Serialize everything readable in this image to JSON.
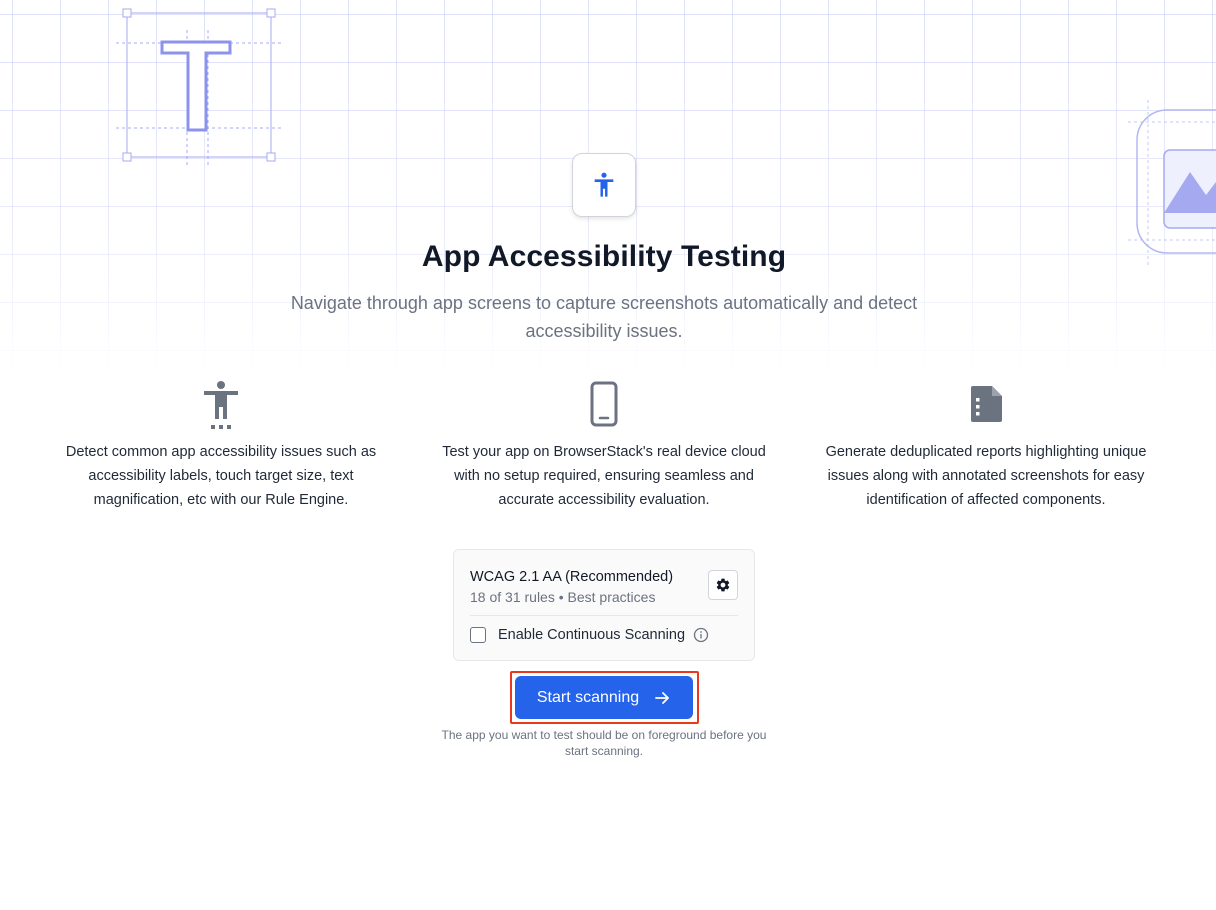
{
  "hero": {
    "title": "App Accessibility Testing",
    "subtitle": "Navigate through app screens to capture screenshots automatically and detect accessibility issues.",
    "icon": "accessibility-person-icon"
  },
  "features": [
    {
      "icon": "accessibility-figure-icon",
      "text": "Detect common app accessibility issues such as accessibility labels, touch target size, text magnification, etc with our Rule Engine."
    },
    {
      "icon": "mobile-phone-icon",
      "text": "Test your app on BrowserStack's real device cloud with no setup required, ensuring seamless and accurate accessibility evaluation."
    },
    {
      "icon": "report-document-icon",
      "text": "Generate deduplicated reports highlighting unique issues along with annotated screenshots for easy identification of affected components."
    }
  ],
  "settings": {
    "standard": "WCAG 2.1 AA (Recommended)",
    "rules_summary": "18 of 31 rules • Best practices",
    "continuous_scanning_label": "Enable Continuous Scanning",
    "continuous_scanning_checked": false
  },
  "actions": {
    "start_label": "Start scanning",
    "helper_text": "The app you want to test should be on foreground before you start scanning."
  },
  "colors": {
    "primary": "#2563eb",
    "highlight_outline": "#e8391d",
    "grid": "#a5aaf0",
    "icon_gray": "#6b7280"
  }
}
